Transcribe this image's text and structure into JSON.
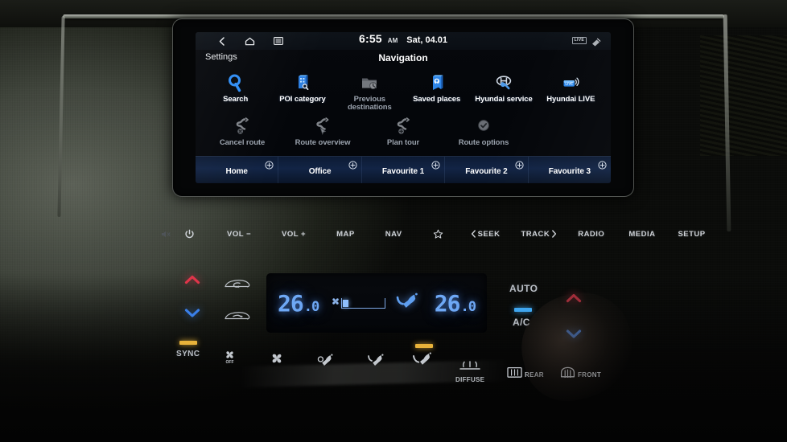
{
  "statusbar": {
    "back_icon": "chevron-left-icon",
    "home_icon": "home-icon",
    "menu_icon": "menu-icon",
    "time": "6:55",
    "ampm": "AM",
    "date": "Sat, 04.01",
    "live_badge": "LIVE",
    "link_icon": "connection-icon"
  },
  "header": {
    "settings_label": "Settings",
    "title": "Navigation"
  },
  "menu": {
    "row1": [
      {
        "label": "Search",
        "icon": "magnifier-icon",
        "enabled": true
      },
      {
        "label": "POI category",
        "icon": "poi-building-icon",
        "enabled": true
      },
      {
        "label": "Previous destinations",
        "icon": "folder-clock-icon",
        "enabled": false
      },
      {
        "label": "Saved places",
        "icon": "bookmark-pin-icon",
        "enabled": true
      },
      {
        "label": "Hyundai service",
        "icon": "hyundai-wrench-icon",
        "enabled": true
      },
      {
        "label": "Hyundai LIVE",
        "icon": "live-signal-icon",
        "enabled": true
      }
    ],
    "row2": [
      {
        "label": "Cancel route",
        "icon": "route-cancel-icon",
        "enabled": false
      },
      {
        "label": "Route overview",
        "icon": "route-overview-icon",
        "enabled": false
      },
      {
        "label": "Plan tour",
        "icon": "route-add-icon",
        "enabled": false
      },
      {
        "label": "Route options",
        "icon": "route-options-icon",
        "enabled": false
      }
    ]
  },
  "favourites": {
    "add_icon": "plus-circle-icon",
    "items": [
      {
        "label": "Home"
      },
      {
        "label": "Office"
      },
      {
        "label": "Favourite 1"
      },
      {
        "label": "Favourite 2"
      },
      {
        "label": "Favourite 3"
      }
    ]
  },
  "hardkeys": [
    {
      "label": "",
      "icon": "mute-icon",
      "faint": true
    },
    {
      "label": "",
      "icon": "power-icon",
      "faint": false
    },
    {
      "label": "VOL −",
      "icon": "",
      "faint": false
    },
    {
      "label": "VOL +",
      "icon": "",
      "faint": false
    },
    {
      "label": "MAP",
      "icon": "",
      "faint": false
    },
    {
      "label": "NAV",
      "icon": "",
      "faint": false
    },
    {
      "label": "",
      "icon": "star-icon",
      "faint": false
    },
    {
      "label": "SEEK",
      "icon": "chevron-left-icon",
      "faint": false
    },
    {
      "label": "TRACK",
      "icon": "chevron-right-icon",
      "faint": false
    },
    {
      "label": "RADIO",
      "icon": "",
      "faint": false
    },
    {
      "label": "MEDIA",
      "icon": "",
      "faint": false
    },
    {
      "label": "SETUP",
      "icon": "",
      "faint": false
    }
  ],
  "climate": {
    "driver_temp_int": "26",
    "driver_temp_dec": ".0",
    "passenger_temp_int": "26",
    "passenger_temp_dec": ".0",
    "fan_icon": "fan-icon",
    "fan_level": 1,
    "fan_level_max": 8,
    "airflow_icon": "airflow-seat-icon",
    "sync_label": "SYNC",
    "auto_label": "AUTO",
    "ac_label": "A/C",
    "diffuse_label": "DIFFUSE",
    "rear_label": "REAR",
    "front_label": "FRONT",
    "fan_off_label": "OFF",
    "left_up_icon": "chevron-up-icon",
    "left_down_icon": "chevron-down-icon",
    "right_up_icon": "chevron-up-icon",
    "right_down_icon": "chevron-down-icon",
    "recirc_icon": "car-recirculate-icon",
    "fresh_icon": "car-fresh-air-icon",
    "fan_off_icon": "fan-off-icon",
    "fan_on_icon": "fan-on-icon",
    "mode_face_icon": "airflow-face-icon",
    "mode_feet_icon": "airflow-feet-icon",
    "mode_facefeet_icon": "airflow-face-feet-icon",
    "defrost_rear_icon": "rear-defrost-icon",
    "defrost_front_icon": "front-defrost-icon",
    "indicator_amber": "#e8b23a",
    "indicator_blue": "#3fa6f0"
  }
}
